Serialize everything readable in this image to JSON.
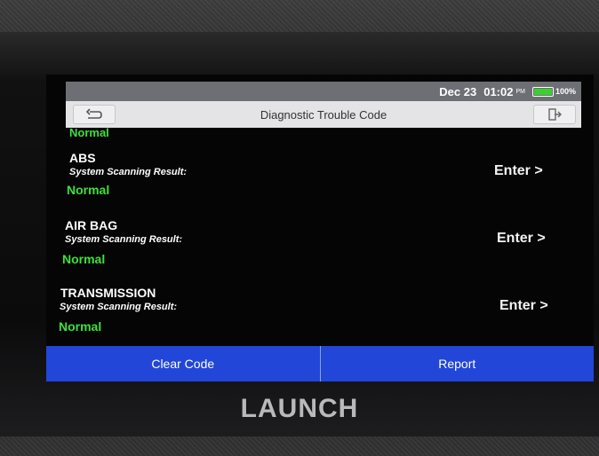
{
  "status": {
    "date": "Dec 23",
    "time": "01:02",
    "ampm": "PM",
    "battery": "100%"
  },
  "titlebar": {
    "title": "Diagnostic Trouble Code",
    "back_icon": "back-arrow-icon",
    "exit_icon": "exit-icon"
  },
  "list": {
    "partial_result": "Normal",
    "items": [
      {
        "name": "ABS",
        "label": "System Scanning Result:",
        "result": "Normal",
        "action": "Enter >"
      },
      {
        "name": "AIR BAG",
        "label": "System Scanning Result:",
        "result": "Normal",
        "action": "Enter >"
      },
      {
        "name": "TRANSMISSION",
        "label": "System Scanning Result:",
        "result": "Normal",
        "action": "Enter >"
      }
    ]
  },
  "bottom": {
    "clear_label": "Clear Code",
    "report_label": "Report"
  },
  "brand": "LAUNCH",
  "colors": {
    "accent": "#2146d8",
    "ok": "#3de03a",
    "statusbar": "#6d6f74"
  }
}
